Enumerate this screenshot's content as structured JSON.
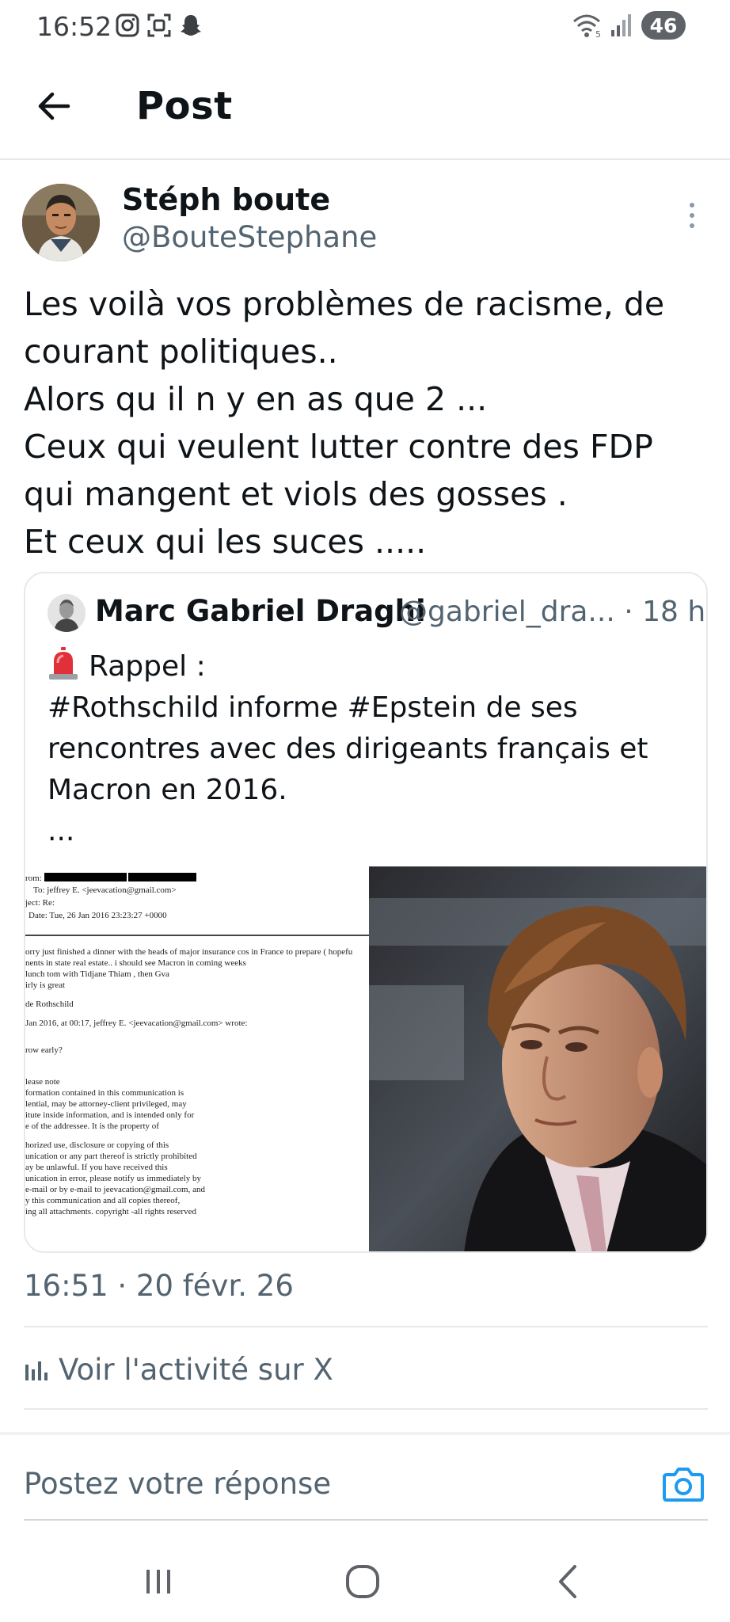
{
  "status_bar": {
    "time": "16:52",
    "battery": "46",
    "icons": [
      "instagram-icon",
      "screenshot-icon",
      "snapchat-icon",
      "wifi-icon",
      "signal-icon"
    ]
  },
  "header": {
    "title": "Post"
  },
  "post": {
    "author_name": "Stéph boute",
    "author_handle": "@BouteStephane",
    "text_lines": [
      "Les voilà vos problèmes de racisme, de",
      "courant politiques..",
      "Alors qu il n y en as que 2 ...",
      "Ceux qui veulent lutter contre des FDP",
      "qui mangent et viols des gosses  .",
      "Et ceux qui les suces ....."
    ],
    "timestamp": "16:51 · 20 févr. 26"
  },
  "quote": {
    "author_name": "Marc Gabriel Draghi",
    "author_meta": "@gabriel_dra... · 18 h",
    "text_lines": [
      "Rappel :",
      "#Rothschild informe #Epstein de ses",
      "rencontres avec des dirigeants français et",
      "Macron en 2016.",
      "..."
    ],
    "document_lines": [
      "rom:",
      "To: jeffrey E. <jeevacation@gmail.com>",
      "ject: Re:",
      "Date: Tue, 26 Jan 2016 23:23:27 +0000",
      "orry just finished a dinner with the heads of major insurance cos in France to prepare ( hopefu",
      "nents in state real estate.. i should see Macron in coming weeks",
      " lunch tom with Tidjane Thiam , then Gva",
      "irly is great",
      " de Rothschild",
      "Jan 2016, at 00:17, jeffrey E. <jeevacation@gmail.com> wrote:",
      "row early?",
      "lease note",
      "formation contained in this communication is",
      "lential, may be attorney-client privileged, may",
      "itute inside information, and is intended only for",
      "e of the addressee. It is the property of",
      "horized use, disclosure or copying of this",
      "unication or any part thereof is strictly prohibited",
      "ay be unlawful. If you have received this",
      "unication in error, please notify us immediately by",
      " e-mail or by e-mail to jeevacation@gmail.com, and",
      "y this communication and all copies thereof,",
      "ing all attachments. copyright -all rights reserved"
    ]
  },
  "activity": {
    "label": "Voir l'activité sur X"
  },
  "reply": {
    "placeholder": "Postez votre réponse"
  },
  "colors": {
    "accent": "#1d9bf0",
    "secondary_text": "#536471",
    "primary_text": "#0f1419"
  }
}
